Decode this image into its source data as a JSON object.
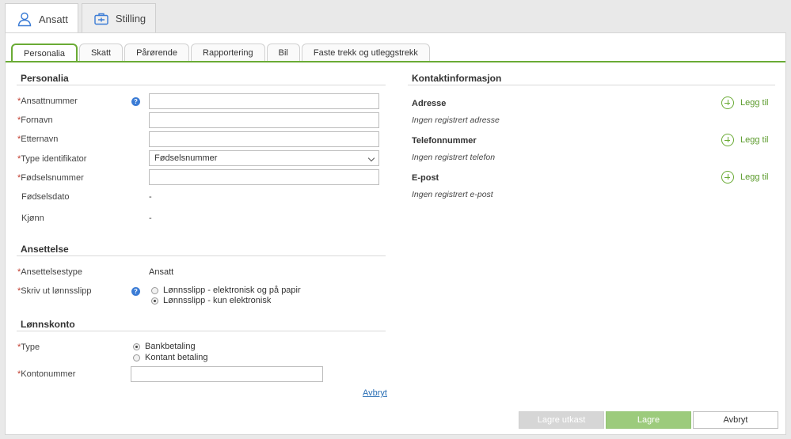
{
  "top_tabs": [
    {
      "label": "Ansatt",
      "icon": "person-icon",
      "active": true
    },
    {
      "label": "Stilling",
      "icon": "briefcase-icon",
      "active": false
    }
  ],
  "sub_tabs": [
    "Personalia",
    "Skatt",
    "Pårørende",
    "Rapportering",
    "Bil",
    "Faste trekk og utleggstrekk"
  ],
  "personalia": {
    "title": "Personalia",
    "ansattnummer": {
      "label": "Ansattnummer",
      "value": ""
    },
    "fornavn": {
      "label": "Fornavn",
      "value": ""
    },
    "etternavn": {
      "label": "Etternavn",
      "value": ""
    },
    "type_identifikator": {
      "label": "Type identifikator",
      "value": "Fødselsnummer"
    },
    "fodselsnummer": {
      "label": "Fødselsnummer",
      "value": ""
    },
    "fodselsdato": {
      "label": "Fødselsdato",
      "value": "-"
    },
    "kjonn": {
      "label": "Kjønn",
      "value": "-"
    }
  },
  "ansettelse": {
    "title": "Ansettelse",
    "type": {
      "label": "Ansettelsestype",
      "value": "Ansatt"
    },
    "lonnsslipp": {
      "label": "Skriv ut lønnsslipp",
      "options": [
        "Lønnsslipp - elektronisk og på papir",
        "Lønnsslipp - kun elektronisk"
      ],
      "selected": 1
    }
  },
  "lonnskonto": {
    "title": "Lønnskonto",
    "type": {
      "label": "Type",
      "options": [
        "Bankbetaling",
        "Kontant betaling"
      ],
      "selected": 0
    },
    "kontonummer": {
      "label": "Kontonummer",
      "value": ""
    },
    "cancel_link": "Avbryt"
  },
  "kontakt": {
    "title": "Kontaktinformasjon",
    "add_label": "Legg til",
    "adresse": {
      "label": "Adresse",
      "empty": "Ingen registrert adresse"
    },
    "telefon": {
      "label": "Telefonnummer",
      "empty": "Ingen registrert telefon"
    },
    "epost": {
      "label": "E-post",
      "empty": "Ingen registrert e-post"
    }
  },
  "required_marker": "*",
  "help_glyph": "?",
  "buttons": {
    "draft": "Lagre utkast",
    "save": "Lagre",
    "cancel": "Avbryt"
  },
  "colors": {
    "accent": "#6aab35",
    "required": "#c0392b",
    "help": "#3a7bd5",
    "link": "#2a6fb5"
  }
}
